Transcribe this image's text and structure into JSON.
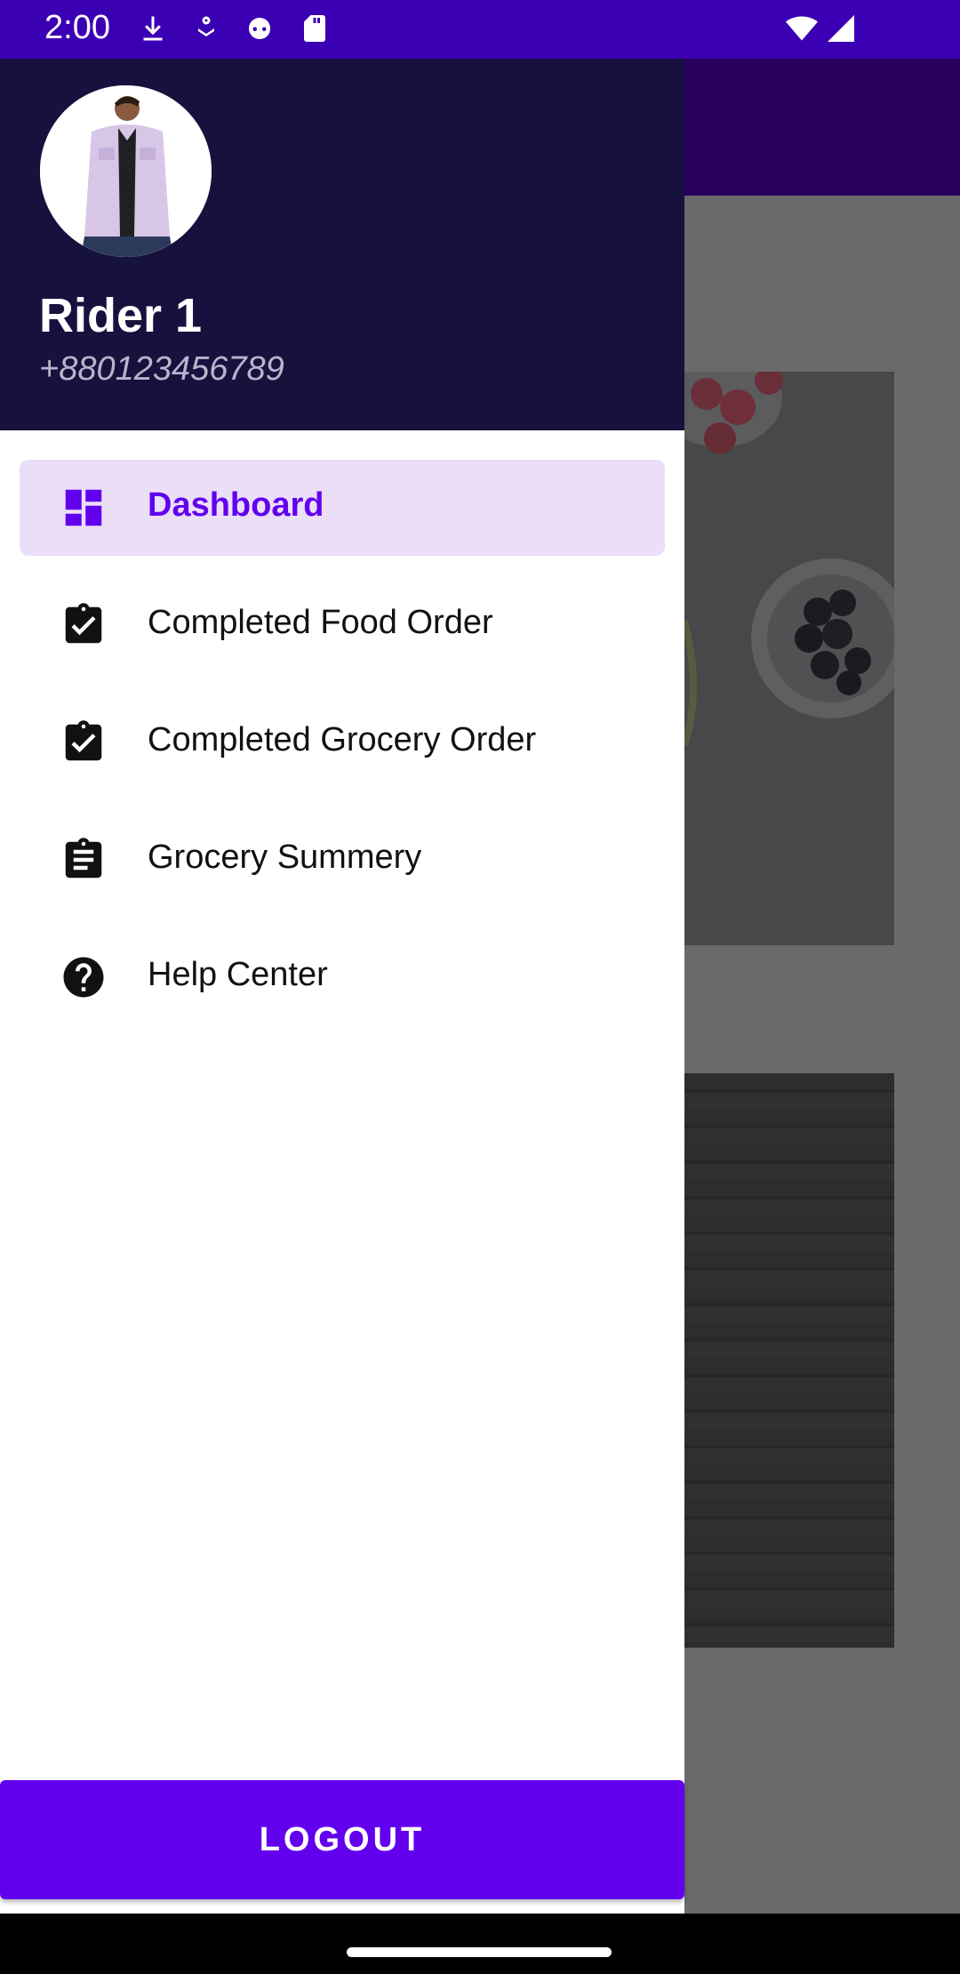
{
  "status_bar": {
    "time": "2:00",
    "icons": [
      "download-icon",
      "gesture-icon",
      "cat-face-icon",
      "sd-card-icon",
      "wifi-icon",
      "cell-signal-icon"
    ]
  },
  "drawer": {
    "header": {
      "name": "Rider 1",
      "phone": "+880123456789"
    },
    "menu_items": [
      {
        "label": "Dashboard",
        "icon": "dashboard-icon",
        "active": true
      },
      {
        "label": "Completed Food Order",
        "icon": "assignment-turned-in-icon",
        "active": false
      },
      {
        "label": "Completed Grocery Order",
        "icon": "assignment-turned-in-icon",
        "active": false
      },
      {
        "label": "Grocery Summery",
        "icon": "assignment-icon",
        "active": false
      },
      {
        "label": "Help Center",
        "icon": "help-icon",
        "active": false
      }
    ],
    "logout_label": "LOGOUT"
  },
  "colors": {
    "status_bar": "#3c00b4",
    "drawer_header": "#17113e",
    "accent": "#6200ee",
    "active_item_bg": "#ebdff8"
  }
}
